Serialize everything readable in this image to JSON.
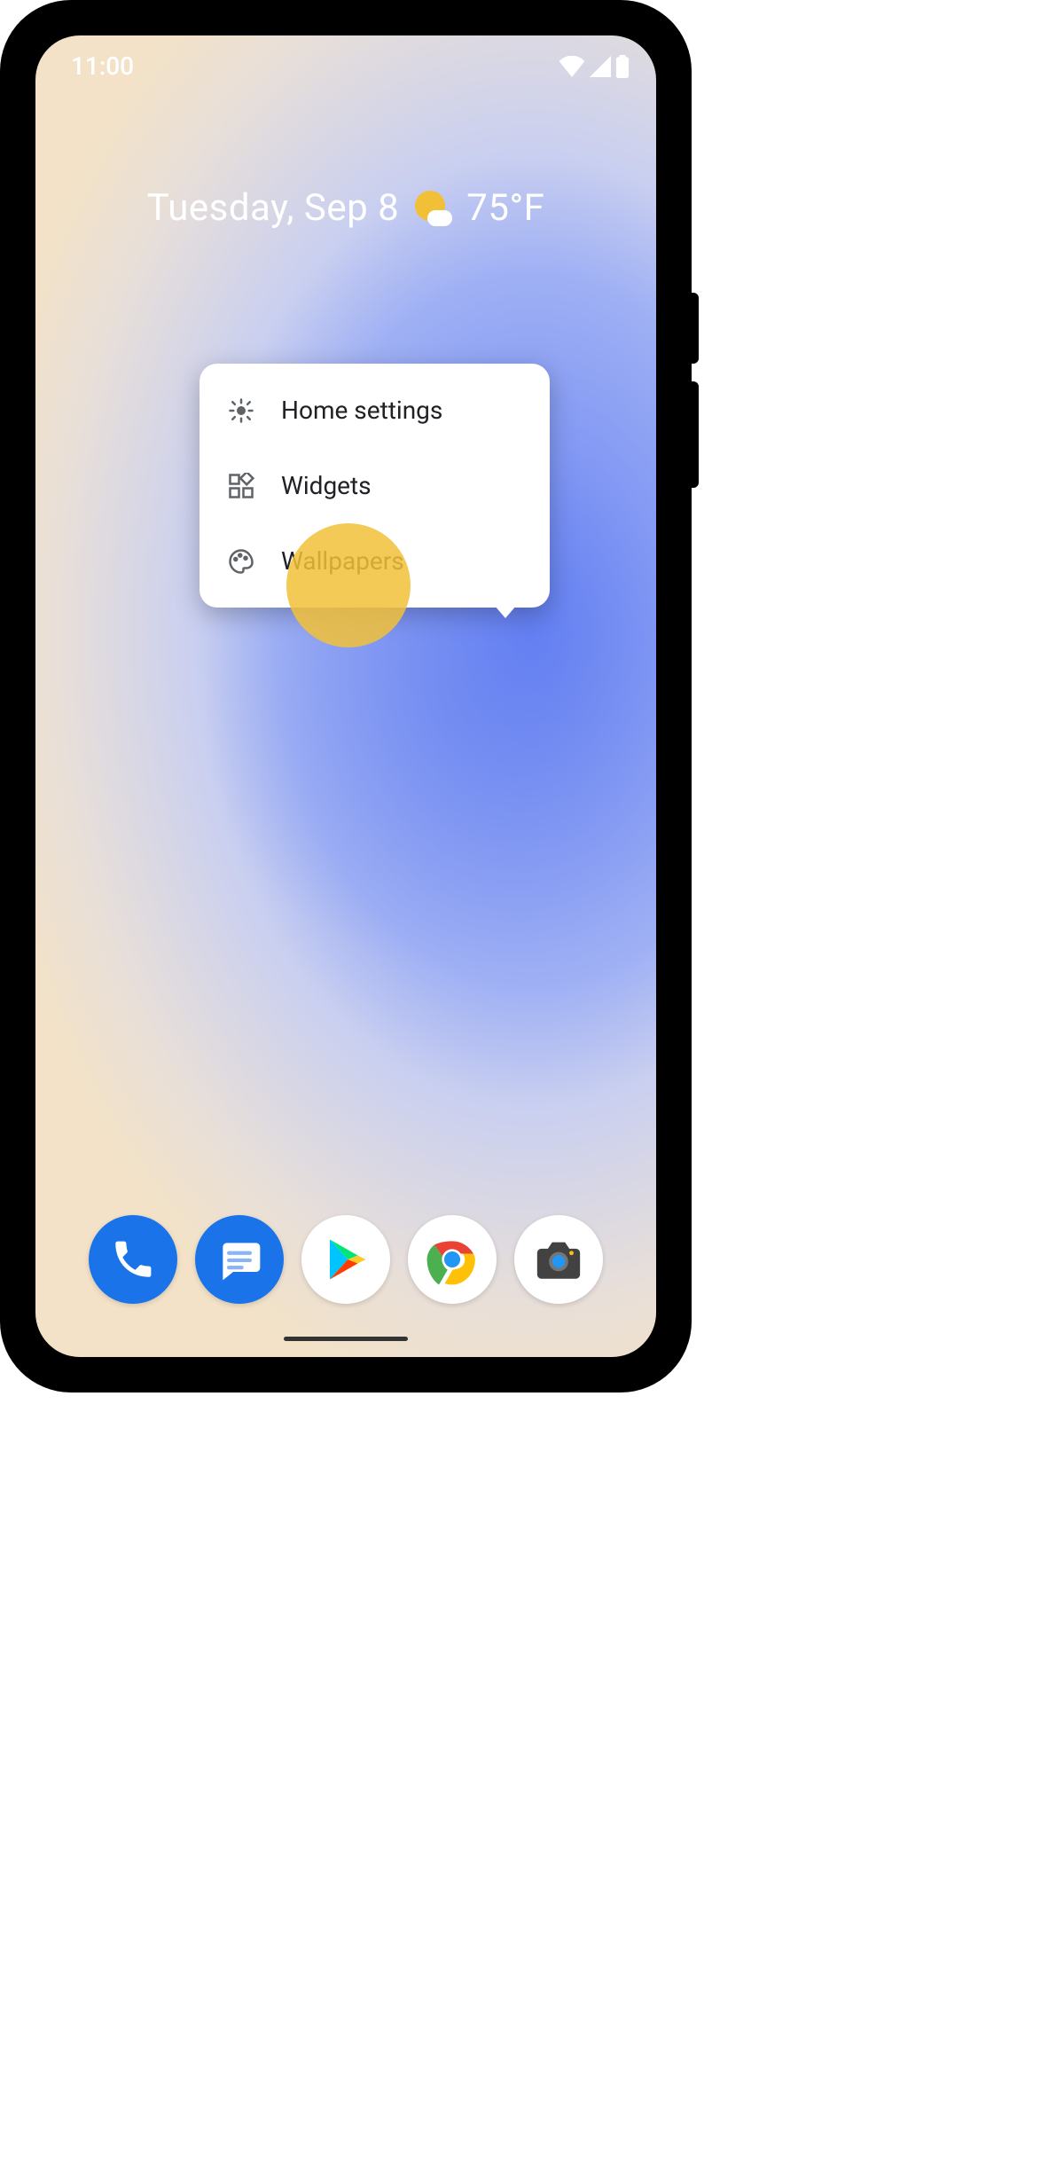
{
  "status": {
    "time": "11:00"
  },
  "widget": {
    "date": "Tuesday, Sep 8",
    "temp": "75°F"
  },
  "menu": {
    "items": [
      {
        "label": "Home settings"
      },
      {
        "label": "Widgets"
      },
      {
        "label": "Wallpapers"
      }
    ]
  },
  "dock": {
    "apps": [
      {
        "name": "phone"
      },
      {
        "name": "messages"
      },
      {
        "name": "play-store"
      },
      {
        "name": "chrome"
      },
      {
        "name": "camera"
      }
    ]
  }
}
